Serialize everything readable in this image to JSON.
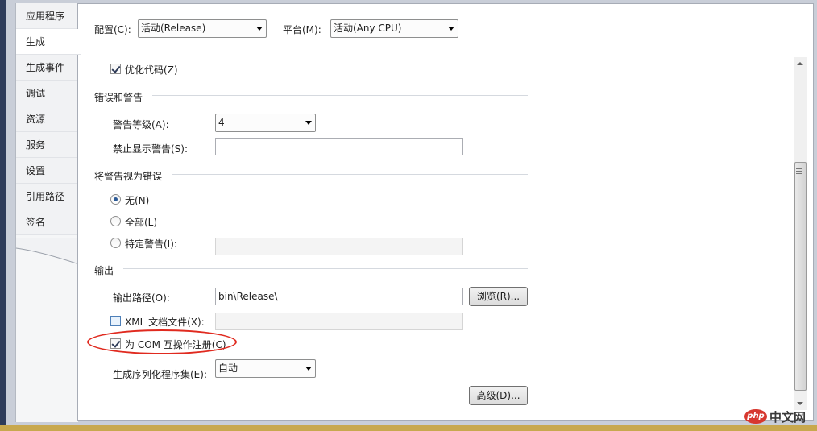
{
  "sidebar": {
    "tabs": [
      {
        "label": "应用程序"
      },
      {
        "label": "生成"
      },
      {
        "label": "生成事件"
      },
      {
        "label": "调试"
      },
      {
        "label": "资源"
      },
      {
        "label": "服务"
      },
      {
        "label": "设置"
      },
      {
        "label": "引用路径"
      },
      {
        "label": "签名"
      }
    ]
  },
  "topbar": {
    "config_label": "配置(C):",
    "config_value": "活动(Release)",
    "platform_label": "平台(M):",
    "platform_value": "活动(Any CPU)"
  },
  "general": {
    "optimize_label": "优化代码(Z)",
    "optimize_checked": true
  },
  "errors": {
    "title": "错误和警告",
    "warning_level_label": "警告等级(A):",
    "warning_level_value": "4",
    "suppress_label": "禁止显示警告(S):",
    "suppress_value": ""
  },
  "treat_warnings": {
    "title": "将警告视为错误",
    "options": [
      {
        "label": "无(N)",
        "selected": true
      },
      {
        "label": "全部(L)",
        "selected": false
      },
      {
        "label": "特定警告(I):",
        "selected": false
      }
    ],
    "specific_value": ""
  },
  "output": {
    "title": "输出",
    "path_label": "输出路径(O):",
    "path_value": "bin\\Release\\",
    "browse_label": "浏览(R)...",
    "xml_label": "XML 文档文件(X):",
    "xml_checked": false,
    "xml_value": "",
    "com_label": "为 COM 互操作注册(C)",
    "com_checked": true,
    "serialization_label": "生成序列化程序集(E):",
    "serialization_value": "自动",
    "advanced_label": "高级(D)..."
  },
  "watermark": {
    "logo": "php",
    "text": "中文网"
  },
  "colors": {
    "annotation": "#e02a1f",
    "frame_dark": "#2e3c5a"
  }
}
